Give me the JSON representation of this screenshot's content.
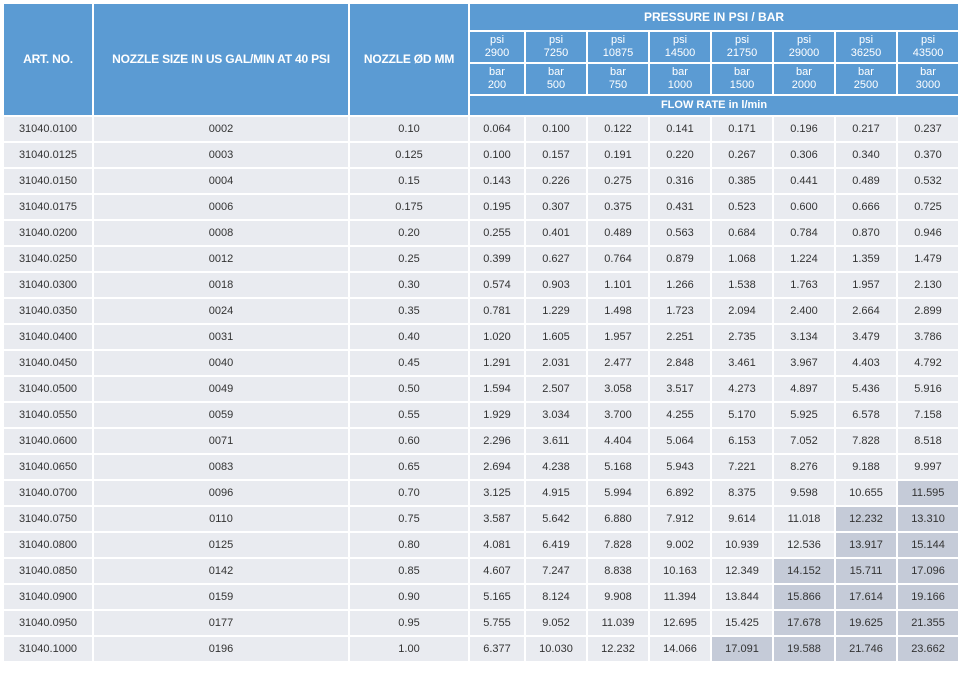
{
  "header": {
    "art_no": "ART. NO.",
    "nozzle_size": "NOZZLE SIZE IN US GAL/MIN AT 40 PSI",
    "nozzle_diameter": "NOZZLE ØD MM",
    "pressure": "PRESSURE IN PSI / BAR",
    "flow_rate": "FLOW RATE in l/min",
    "psi_label": "psi",
    "bar_label": "bar",
    "psi_values": [
      "2900",
      "7250",
      "10875",
      "14500",
      "21750",
      "29000",
      "36250",
      "43500"
    ],
    "bar_values": [
      "200",
      "500",
      "750",
      "1000",
      "1500",
      "2000",
      "2500",
      "3000"
    ]
  },
  "shade_color": "#c5cbd8",
  "rows": [
    {
      "art": "31040.0100",
      "size": "0002",
      "dia": "0.10",
      "flow": [
        "0.064",
        "0.100",
        "0.122",
        "0.141",
        "0.171",
        "0.196",
        "0.217",
        "0.237"
      ],
      "shaded": []
    },
    {
      "art": "31040.0125",
      "size": "0003",
      "dia": "0.125",
      "flow": [
        "0.100",
        "0.157",
        "0.191",
        "0.220",
        "0.267",
        "0.306",
        "0.340",
        "0.370"
      ],
      "shaded": []
    },
    {
      "art": "31040.0150",
      "size": "0004",
      "dia": "0.15",
      "flow": [
        "0.143",
        "0.226",
        "0.275",
        "0.316",
        "0.385",
        "0.441",
        "0.489",
        "0.532"
      ],
      "shaded": []
    },
    {
      "art": "31040.0175",
      "size": "0006",
      "dia": "0.175",
      "flow": [
        "0.195",
        "0.307",
        "0.375",
        "0.431",
        "0.523",
        "0.600",
        "0.666",
        "0.725"
      ],
      "shaded": []
    },
    {
      "art": "31040.0200",
      "size": "0008",
      "dia": "0.20",
      "flow": [
        "0.255",
        "0.401",
        "0.489",
        "0.563",
        "0.684",
        "0.784",
        "0.870",
        "0.946"
      ],
      "shaded": []
    },
    {
      "art": "31040.0250",
      "size": "0012",
      "dia": "0.25",
      "flow": [
        "0.399",
        "0.627",
        "0.764",
        "0.879",
        "1.068",
        "1.224",
        "1.359",
        "1.479"
      ],
      "shaded": []
    },
    {
      "art": "31040.0300",
      "size": "0018",
      "dia": "0.30",
      "flow": [
        "0.574",
        "0.903",
        "1.101",
        "1.266",
        "1.538",
        "1.763",
        "1.957",
        "2.130"
      ],
      "shaded": []
    },
    {
      "art": "31040.0350",
      "size": "0024",
      "dia": "0.35",
      "flow": [
        "0.781",
        "1.229",
        "1.498",
        "1.723",
        "2.094",
        "2.400",
        "2.664",
        "2.899"
      ],
      "shaded": []
    },
    {
      "art": "31040.0400",
      "size": "0031",
      "dia": "0.40",
      "flow": [
        "1.020",
        "1.605",
        "1.957",
        "2.251",
        "2.735",
        "3.134",
        "3.479",
        "3.786"
      ],
      "shaded": []
    },
    {
      "art": "31040.0450",
      "size": "0040",
      "dia": "0.45",
      "flow": [
        "1.291",
        "2.031",
        "2.477",
        "2.848",
        "3.461",
        "3.967",
        "4.403",
        "4.792"
      ],
      "shaded": []
    },
    {
      "art": "31040.0500",
      "size": "0049",
      "dia": "0.50",
      "flow": [
        "1.594",
        "2.507",
        "3.058",
        "3.517",
        "4.273",
        "4.897",
        "5.436",
        "5.916"
      ],
      "shaded": []
    },
    {
      "art": "31040.0550",
      "size": "0059",
      "dia": "0.55",
      "flow": [
        "1.929",
        "3.034",
        "3.700",
        "4.255",
        "5.170",
        "5.925",
        "6.578",
        "7.158"
      ],
      "shaded": []
    },
    {
      "art": "31040.0600",
      "size": "0071",
      "dia": "0.60",
      "flow": [
        "2.296",
        "3.611",
        "4.404",
        "5.064",
        "6.153",
        "7.052",
        "7.828",
        "8.518"
      ],
      "shaded": []
    },
    {
      "art": "31040.0650",
      "size": "0083",
      "dia": "0.65",
      "flow": [
        "2.694",
        "4.238",
        "5.168",
        "5.943",
        "7.221",
        "8.276",
        "9.188",
        "9.997"
      ],
      "shaded": []
    },
    {
      "art": "31040.0700",
      "size": "0096",
      "dia": "0.70",
      "flow": [
        "3.125",
        "4.915",
        "5.994",
        "6.892",
        "8.375",
        "9.598",
        "10.655",
        "11.595"
      ],
      "shaded": [
        7
      ]
    },
    {
      "art": "31040.0750",
      "size": "0110",
      "dia": "0.75",
      "flow": [
        "3.587",
        "5.642",
        "6.880",
        "7.912",
        "9.614",
        "11.018",
        "12.232",
        "13.310"
      ],
      "shaded": [
        6,
        7
      ]
    },
    {
      "art": "31040.0800",
      "size": "0125",
      "dia": "0.80",
      "flow": [
        "4.081",
        "6.419",
        "7.828",
        "9.002",
        "10.939",
        "12.536",
        "13.917",
        "15.144"
      ],
      "shaded": [
        6,
        7
      ]
    },
    {
      "art": "31040.0850",
      "size": "0142",
      "dia": "0.85",
      "flow": [
        "4.607",
        "7.247",
        "8.838",
        "10.163",
        "12.349",
        "14.152",
        "15.711",
        "17.096"
      ],
      "shaded": [
        5,
        6,
        7
      ]
    },
    {
      "art": "31040.0900",
      "size": "0159",
      "dia": "0.90",
      "flow": [
        "5.165",
        "8.124",
        "9.908",
        "11.394",
        "13.844",
        "15.866",
        "17.614",
        "19.166"
      ],
      "shaded": [
        5,
        6,
        7
      ]
    },
    {
      "art": "31040.0950",
      "size": "0177",
      "dia": "0.95",
      "flow": [
        "5.755",
        "9.052",
        "11.039",
        "12.695",
        "15.425",
        "17.678",
        "19.625",
        "21.355"
      ],
      "shaded": [
        5,
        6,
        7
      ]
    },
    {
      "art": "31040.1000",
      "size": "0196",
      "dia": "1.00",
      "flow": [
        "6.377",
        "10.030",
        "12.232",
        "14.066",
        "17.091",
        "19.588",
        "21.746",
        "23.662"
      ],
      "shaded": [
        4,
        5,
        6,
        7
      ]
    }
  ]
}
